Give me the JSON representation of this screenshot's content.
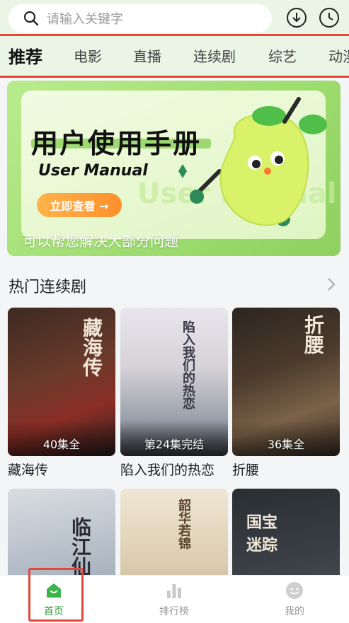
{
  "search": {
    "placeholder": "请输入关键字"
  },
  "header_icons": [
    "download-icon",
    "history-clock-icon"
  ],
  "tabs": [
    {
      "label": "推荐",
      "active": true
    },
    {
      "label": "电影"
    },
    {
      "label": "直播"
    },
    {
      "label": "连续剧"
    },
    {
      "label": "综艺"
    },
    {
      "label": "动漫"
    }
  ],
  "banner": {
    "title": "用户使用手册",
    "subtitle": "User Manual",
    "button": "立即查看 →",
    "watermark": "User Manual",
    "caption": "可以帮您解决大部分问题"
  },
  "section": {
    "title": "热门连续剧",
    "more_icon": "chevron-right-icon"
  },
  "dramas": [
    {
      "title": "藏海传",
      "badge": "40集全",
      "poster_text": "藏海传"
    },
    {
      "title": "陷入我们的热恋",
      "badge": "第24集完结",
      "poster_text": "陷入我们的热恋"
    },
    {
      "title": "折腰",
      "badge": "36集全",
      "poster_text": "折腰"
    },
    {
      "title": "",
      "badge": "",
      "poster_text": "临江仙"
    },
    {
      "title": "",
      "badge": "",
      "poster_text": "韶华若锦"
    },
    {
      "title": "",
      "badge": "",
      "poster_text": "国宝迷踪"
    }
  ],
  "bottom_nav": [
    {
      "label": "首页",
      "icon": "home-icon",
      "active": true
    },
    {
      "label": "排行榜",
      "icon": "bar-chart-icon"
    },
    {
      "label": "我的",
      "icon": "profile-icon"
    }
  ],
  "colors": {
    "accent": "#2f9c3a",
    "highlight": "#e2483a",
    "header_bg": "#eaf5e6"
  }
}
